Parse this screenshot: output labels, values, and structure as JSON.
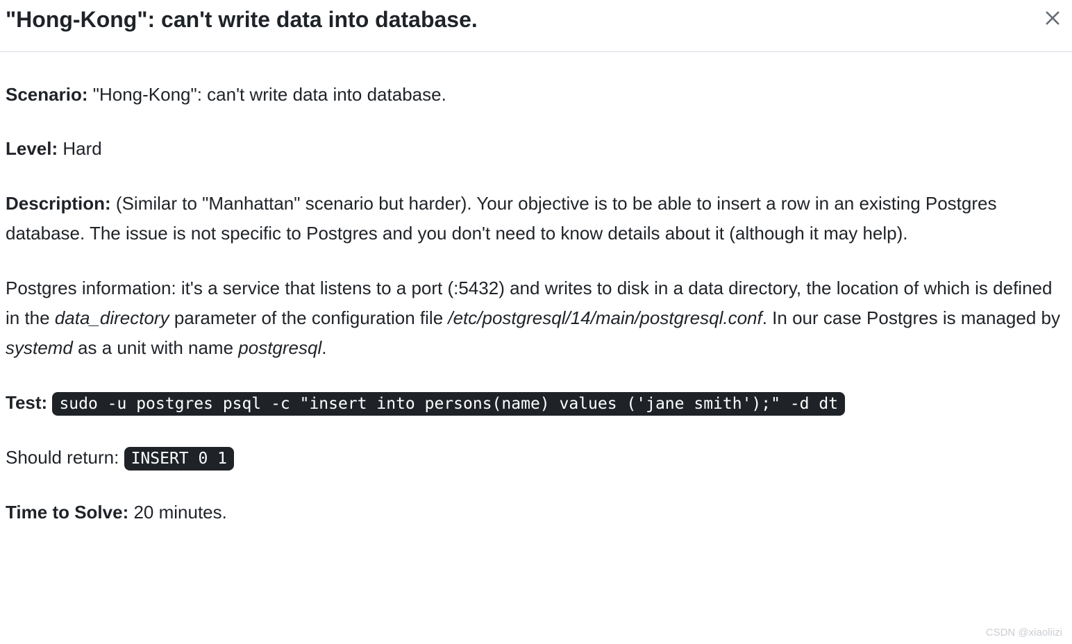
{
  "header": {
    "title": "\"Hong-Kong\": can't write data into database."
  },
  "labels": {
    "scenario": "Scenario:",
    "level": "Level:",
    "description": "Description:",
    "test": "Test:",
    "should_return": "Should return:",
    "time_to_solve": "Time to Solve:"
  },
  "values": {
    "scenario": " \"Hong-Kong\": can't write data into database.",
    "level": " Hard",
    "description_part1": " (Similar to \"Manhattan\" scenario but harder). Your objective is to be able to insert a row in an existing Postgres database. The issue is not specific to Postgres and you don't need to know details about it (although it may help).",
    "postgres_info_part1": "Postgres information: it's a service that listens to a port (:5432) and writes to disk in a data directory, the location of which is defined in the ",
    "data_directory": "data_directory",
    "postgres_info_part2": " parameter of the configuration file ",
    "conf_path": "/etc/postgresql/14/main/postgresql.conf",
    "postgres_info_part3": ". In our case Postgres is managed by ",
    "systemd": "systemd",
    "postgres_info_part4": " as a unit with name ",
    "postgresql": "postgresql",
    "postgres_info_part5": ".",
    "test_code": "sudo -u postgres psql -c \"insert into persons(name) values ('jane smith');\" -d dt",
    "return_code": "INSERT 0 1",
    "time_to_solve": " 20 minutes."
  },
  "watermark": "CSDN @xiaoliizi"
}
